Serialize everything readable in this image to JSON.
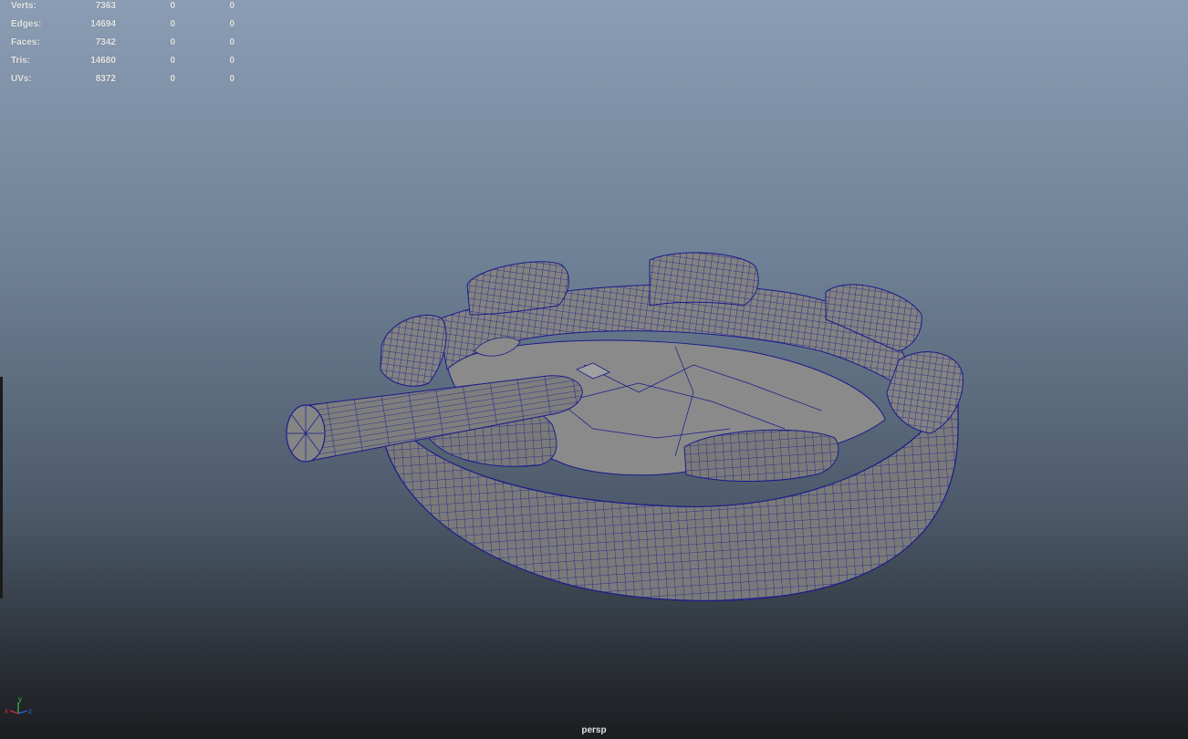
{
  "hud": {
    "rows": [
      {
        "label": "Verts:",
        "total": "7363",
        "selected": "0",
        "component": "0"
      },
      {
        "label": "Edges:",
        "total": "14694",
        "selected": "0",
        "component": "0"
      },
      {
        "label": "Faces:",
        "total": "7342",
        "selected": "0",
        "component": "0"
      },
      {
        "label": "Tris:",
        "total": "14680",
        "selected": "0",
        "component": "0"
      },
      {
        "label": "UVs:",
        "total": "8372",
        "selected": "0",
        "component": "0"
      }
    ]
  },
  "axis_gizmo": {
    "x": "x",
    "y": "y",
    "z": "z"
  },
  "camera": {
    "name": "persp"
  },
  "colors": {
    "wireframe": "#1a1a8c",
    "mesh_fill": "#7d7d7d",
    "axis_x": "#d03030",
    "axis_y": "#40c040",
    "axis_z": "#3060e0"
  },
  "icons": [
    "axis-gizmo-icon"
  ]
}
